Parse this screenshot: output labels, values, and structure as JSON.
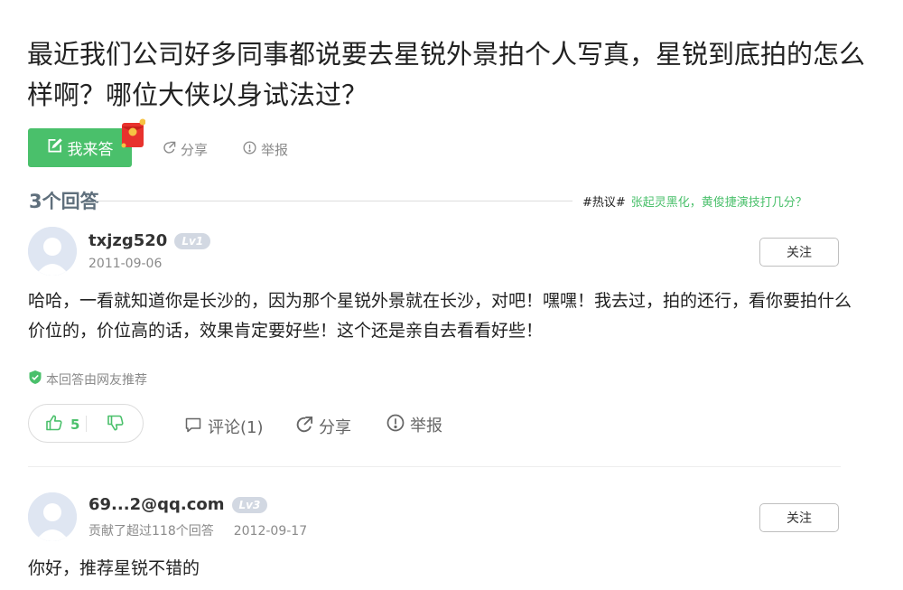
{
  "question": {
    "title": "最近我们公司好多同事都说要去星锐外景拍个人写真，星锐到底拍的怎么样啊？哪位大侠以身试法过？",
    "answer_button": "我来答",
    "share": "分享",
    "report": "举报"
  },
  "answers_count": "3个回答",
  "hot_topic": {
    "tag": "#热议#",
    "text": "张起灵黑化，黄俊捷演技打几分？"
  },
  "answers": [
    {
      "username": "txjzg520",
      "level": "Lv1",
      "date": "2011-09-06",
      "follow": "关注",
      "content": "哈哈，一看就知道你是长沙的，因为那个星锐外景就在长沙，对吧！嘿嘿！我去过，拍的还行，看你要拍什么价位的，价位高的话，效果肯定要好些！这个还是亲自去看看好些！",
      "recommended": "本回答由网友推荐",
      "likes": "5",
      "comments": "评论(1)",
      "share": "分享",
      "report": "举报"
    },
    {
      "username": "69...2@qq.com",
      "level": "Lv3",
      "contribution": "贡献了超过118个回答",
      "date": "2012-09-17",
      "follow": "关注",
      "content": "你好，推荐星锐不错的"
    }
  ],
  "colors": {
    "accent_green": "#4ac06b",
    "level_badge": "#d2d8e2",
    "muted_text": "#8a8a8a",
    "count_text": "#5f6f7c"
  },
  "icons": {
    "answer_button": "edit-icon",
    "redpack": "red-envelope-icon",
    "share": "share-icon",
    "report": "report-icon",
    "recommend": "shield-check-icon",
    "like": "thumbs-up-icon",
    "dislike": "thumbs-down-icon",
    "comment": "comment-icon",
    "avatar": "default-avatar-icon"
  }
}
